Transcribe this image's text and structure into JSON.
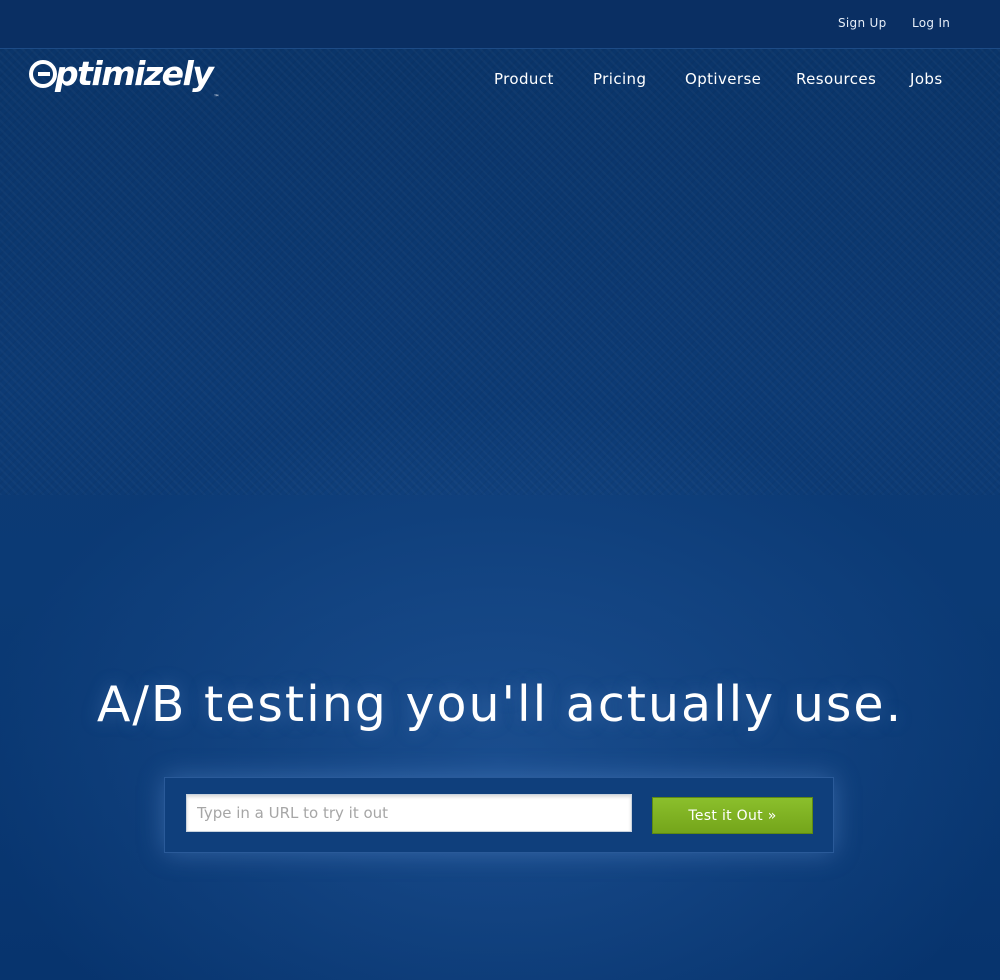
{
  "topbar": {
    "sign_up": "Sign Up",
    "log_in": "Log In"
  },
  "logo": {
    "text": "ptimizely",
    "trademark": "™"
  },
  "nav": {
    "items": [
      {
        "label": "Product"
      },
      {
        "label": "Pricing"
      },
      {
        "label": "Optiverse"
      },
      {
        "label": "Resources"
      },
      {
        "label": "Jobs"
      }
    ]
  },
  "hero": {
    "headline": "A/B testing you'll actually use.",
    "url_placeholder": "Type in a URL to try it out",
    "url_value": "",
    "button_label": "Test it Out »"
  },
  "colors": {
    "background": "#0b3a75",
    "button_green": "#7fb323"
  }
}
